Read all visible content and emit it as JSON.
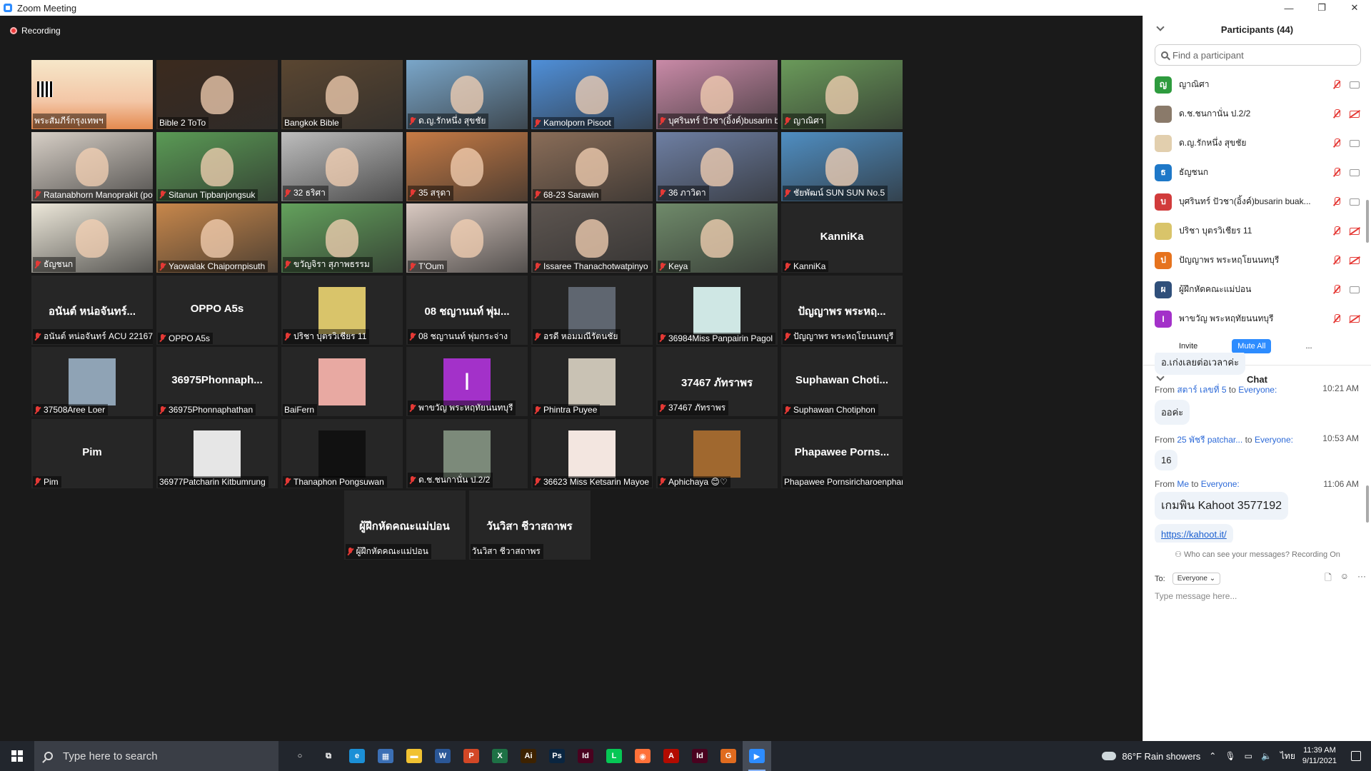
{
  "window": {
    "title": "Zoom Meeting",
    "minimize": "—",
    "restore": "❐",
    "close": "✕"
  },
  "recording": {
    "label": "Recording"
  },
  "tiles": [
    {
      "row": 0,
      "col": 0,
      "label": "พระสัมภีร์กรุงเทพฯ",
      "kind": "poster",
      "mic_off": false
    },
    {
      "row": 0,
      "col": 1,
      "label": "Bible 2 ToTo",
      "kind": "photo",
      "color": "#3b2a1e",
      "mic_off": false
    },
    {
      "row": 0,
      "col": 2,
      "label": "Bangkok Bible",
      "kind": "photo",
      "color": "#5a4631",
      "mic_off": false,
      "active": true
    },
    {
      "row": 0,
      "col": 3,
      "label": "ด.ญ.รักหนึ่ง สุขชัย",
      "kind": "photo",
      "color": "#7aa6c9",
      "mic_off": true
    },
    {
      "row": 0,
      "col": 4,
      "label": "Kamolporn Pisoot",
      "kind": "photo",
      "color": "#4f8fd8",
      "mic_off": true
    },
    {
      "row": 0,
      "col": 5,
      "label": "บุศรินทร์ ปัวชา(อิ้งค์)busarin bu...",
      "kind": "photo",
      "color": "#c98aa7",
      "mic_off": true
    },
    {
      "row": 0,
      "col": 6,
      "label": "ญาณิศา",
      "kind": "photo",
      "color": "#6a9a5a",
      "mic_off": true
    },
    {
      "row": 1,
      "col": 0,
      "label": "Ratanabhorn Manoprakit (pow)",
      "kind": "photo",
      "color": "#d7cfc6",
      "mic_off": true
    },
    {
      "row": 1,
      "col": 1,
      "label": "Sitanun Tipbanjongsuk",
      "kind": "photo",
      "color": "#5a9a55",
      "mic_off": true
    },
    {
      "row": 1,
      "col": 2,
      "label": "32 ธริศา",
      "kind": "photo",
      "color": "#bdbdbd",
      "mic_off": true
    },
    {
      "row": 1,
      "col": 3,
      "label": "35 สรุดา",
      "kind": "photo",
      "color": "#c77b45",
      "mic_off": true
    },
    {
      "row": 1,
      "col": 4,
      "label": "68-23 Sarawin",
      "kind": "photo",
      "color": "#8a6d58",
      "mic_off": true
    },
    {
      "row": 1,
      "col": 5,
      "label": "36 ภาวิดา",
      "kind": "photo",
      "color": "#6e7fa3",
      "mic_off": true
    },
    {
      "row": 1,
      "col": 6,
      "label": "ชัยพัฒน์ SUN SUN No.5",
      "kind": "photo",
      "color": "#4f8ec2",
      "mic_off": true
    },
    {
      "row": 2,
      "col": 0,
      "label": "ธัญชนก",
      "kind": "photo",
      "color": "#ece7d9",
      "mic_off": true
    },
    {
      "row": 2,
      "col": 1,
      "label": "Yaowalak Chaipornpisuth",
      "kind": "photo",
      "color": "#c7874b",
      "mic_off": true
    },
    {
      "row": 2,
      "col": 2,
      "label": "ขวัญจิรา สุภาพธรรม",
      "kind": "photo",
      "color": "#63a15c",
      "mic_off": true
    },
    {
      "row": 2,
      "col": 3,
      "label": "T'Oum",
      "kind": "photo",
      "color": "#d9c9c1",
      "mic_off": true
    },
    {
      "row": 2,
      "col": 4,
      "label": "Issaree Thanachotwatpinyo",
      "kind": "photo",
      "color": "#5d5550",
      "mic_off": true
    },
    {
      "row": 2,
      "col": 5,
      "label": "Keya",
      "kind": "photo",
      "color": "#6f8a6a",
      "mic_off": true
    },
    {
      "row": 2,
      "col": 6,
      "label": "KanniKa",
      "kind": "name",
      "center": "KanniKa",
      "mic_off": true
    },
    {
      "row": 3,
      "col": 0,
      "label": "อนันต์ หน่อจันทร์ ACU 22167",
      "kind": "name",
      "center": "อนันต์ หน่อจันทร์...",
      "mic_off": true
    },
    {
      "row": 3,
      "col": 1,
      "label": "OPPO A5s",
      "kind": "name",
      "center": "OPPO A5s",
      "mic_off": true
    },
    {
      "row": 3,
      "col": 2,
      "label": "ปริชา บุตรวิเชียร  11",
      "kind": "avatar",
      "color": "#d9c46a",
      "mic_off": true
    },
    {
      "row": 3,
      "col": 3,
      "label": "08 ชญานนท์ พุ่มกระจ่าง",
      "kind": "name",
      "center": "08 ชญานนท์ พุ่ม...",
      "mic_off": true
    },
    {
      "row": 3,
      "col": 4,
      "label": "อรดี หอมมณีรัตนชัย",
      "kind": "avatar",
      "color": "#5f6670",
      "mic_off": true
    },
    {
      "row": 3,
      "col": 5,
      "label": "36984Miss Panpairin Pagol",
      "kind": "avatar",
      "color": "#cfe7e4",
      "mic_off": true
    },
    {
      "row": 3,
      "col": 6,
      "label": "ปัญญาพร พระหฤโยนนทบุรี",
      "kind": "name",
      "center": "ปัญญาพร พระหฤ...",
      "mic_off": true
    },
    {
      "row": 4,
      "col": 0,
      "label": "37508Aree Loer",
      "kind": "avatar",
      "color": "#8fa3b5",
      "mic_off": true
    },
    {
      "row": 4,
      "col": 1,
      "label": "36975Phonnaphathan",
      "kind": "name",
      "center": "36975Phonnaph...",
      "mic_off": true
    },
    {
      "row": 4,
      "col": 2,
      "label": "BaiFern",
      "kind": "avatar",
      "color": "#e8a9a2",
      "mic_off": false
    },
    {
      "row": 4,
      "col": 3,
      "label": "พาขวัญ พระหฤทัยนนทบุรี",
      "kind": "letter",
      "letter": "I",
      "color": "#a331c9",
      "mic_off": true
    },
    {
      "row": 4,
      "col": 4,
      "label": "Phintra Puyee",
      "kind": "avatar",
      "color": "#c9c2b4",
      "mic_off": true
    },
    {
      "row": 4,
      "col": 5,
      "label": "37467 ภัทราพร",
      "kind": "name",
      "center": "37467 ภัทราพร",
      "mic_off": true
    },
    {
      "row": 4,
      "col": 6,
      "label": "Suphawan Chotiphon",
      "kind": "name",
      "center": "Suphawan  Choti...",
      "mic_off": true
    },
    {
      "row": 5,
      "col": 0,
      "label": "Pim",
      "kind": "name",
      "center": "Pim",
      "mic_off": true
    },
    {
      "row": 5,
      "col": 1,
      "label": "36977Patcharin Kitbumrung",
      "kind": "avatar",
      "color": "#e6e6e6",
      "mic_off": false
    },
    {
      "row": 5,
      "col": 2,
      "label": "Thanaphon Pongsuwan",
      "kind": "avatar",
      "color": "#111111",
      "mic_off": true
    },
    {
      "row": 5,
      "col": 3,
      "label": "ด.ช.ชนกานั่น ป.2/2",
      "kind": "avatar",
      "color": "#7c8a7a",
      "mic_off": true
    },
    {
      "row": 5,
      "col": 4,
      "label": "36623 Miss Ketsarin Mayoe",
      "kind": "avatar",
      "color": "#f3e6e0",
      "mic_off": true
    },
    {
      "row": 5,
      "col": 5,
      "label": "Aphichaya 😊♡",
      "kind": "avatar",
      "color": "#a0682f",
      "mic_off": true
    },
    {
      "row": 5,
      "col": 6,
      "label": "Phapawee Pornsiricharoenphan",
      "kind": "name",
      "center": "Phapawee  Porns...",
      "mic_off": false
    },
    {
      "row": 6,
      "col": 2.5,
      "label": "ผู้ฝึกหัดคณะแม่ปอน",
      "kind": "name",
      "center": "ผู้ฝึกหัดคณะแม่ปอน",
      "mic_off": true
    },
    {
      "row": 6,
      "col": 3.5,
      "label": "วันวิสา ชีวาสถาพร",
      "kind": "name",
      "center": "วันวิสา ชีวาสถาพร",
      "mic_off": false
    }
  ],
  "participants": {
    "title": "Participants (44)",
    "search_placeholder": "Find a participant",
    "list": [
      {
        "name": "ญาณิศา",
        "initial": "ญ",
        "color": "#2e9b3e",
        "cam_off": false
      },
      {
        "name": "ด.ช.ชนกานั่น ป.2/2",
        "initial": "",
        "color": "#8a7a6a",
        "cam_off": true
      },
      {
        "name": "ด.ญ.รักหนึ่ง สุขชัย",
        "initial": "",
        "color": "#e2cfae",
        "cam_off": false
      },
      {
        "name": "ธัญชนก",
        "initial": "ธ",
        "color": "#1e78c8",
        "cam_off": false
      },
      {
        "name": "บุศรินทร์ ปัวชา(อิ้งค์)busarin buak...",
        "initial": "บ",
        "color": "#d13b3b",
        "cam_off": false
      },
      {
        "name": "ปริชา บุตรวิเชียร  11",
        "initial": "",
        "color": "#d9c46a",
        "cam_off": true
      },
      {
        "name": "ปัญญาพร พระหฤโยนนทบุรี",
        "initial": "ป",
        "color": "#e6731e",
        "cam_off": true
      },
      {
        "name": "ผู้ฝึกหัดคณะแม่ปอน",
        "initial": "ผ",
        "color": "#2f4f7a",
        "cam_off": false
      },
      {
        "name": "พาขวัญ พระหฤทัยนนทบุรี",
        "initial": "I",
        "color": "#a331c9",
        "cam_off": true
      }
    ],
    "buttons": {
      "invite": "Invite",
      "mute_all": "Mute All",
      "more": "..."
    }
  },
  "chat": {
    "title": "Chat",
    "top_bubble": "อ.เก่งเลยต่อเวลาค่ะ",
    "messages": [
      {
        "from": "From",
        "sender": "สตาร์ เลขที่ 5",
        "to": "to",
        "target": "Everyone:",
        "time": "10:21 AM",
        "text": "ออค่ะ"
      },
      {
        "from": "From",
        "sender": "25 พัชรี patchar...",
        "to": "to",
        "target": "Everyone:",
        "time": "10:53 AM",
        "text": "16"
      },
      {
        "from": "From",
        "sender": "Me",
        "to": "to",
        "target": "Everyone:",
        "time": "11:06 AM",
        "text": "เกมพิน Kahoot 3577192",
        "link": "https://kahoot.it/"
      }
    ],
    "who_can_see": "Who can see your messages? Recording On",
    "to_label": "To:",
    "to_value": "Everyone",
    "input_placeholder": "Type message here..."
  },
  "taskbar": {
    "search_placeholder": "Type here to search",
    "weather": "86°F  Rain showers",
    "lang": "ไทย",
    "time": "11:39 AM",
    "date": "9/11/2021",
    "apps": [
      {
        "name": "cortana-icon",
        "color": "transparent",
        "text": "○"
      },
      {
        "name": "task-view-icon",
        "color": "transparent",
        "text": "⧉"
      },
      {
        "name": "edge-icon",
        "color": "#1b8fd6",
        "text": "e"
      },
      {
        "name": "calculator-icon",
        "color": "#3b6fb5",
        "text": "▦"
      },
      {
        "name": "file-explorer-icon",
        "color": "#f1c232",
        "text": "▬"
      },
      {
        "name": "word-icon",
        "color": "#2b5797",
        "text": "W"
      },
      {
        "name": "powerpoint-icon",
        "color": "#d24726",
        "text": "P"
      },
      {
        "name": "excel-icon",
        "color": "#1e7145",
        "text": "X"
      },
      {
        "name": "illustrator-icon",
        "color": "#3d2200",
        "text": "Ai"
      },
      {
        "name": "photoshop-icon",
        "color": "#0a2540",
        "text": "Ps"
      },
      {
        "name": "indesign-icon",
        "color": "#49021f",
        "text": "Id"
      },
      {
        "name": "line-icon",
        "color": "#06c755",
        "text": "L"
      },
      {
        "name": "firefox-icon",
        "color": "#ff7139",
        "text": "◉"
      },
      {
        "name": "acrobat-icon",
        "color": "#b30b00",
        "text": "A"
      },
      {
        "name": "indesign2-icon",
        "color": "#49021f",
        "text": "Id"
      },
      {
        "name": "grammarly-icon",
        "color": "#e06b1f",
        "text": "G"
      },
      {
        "name": "zoom-icon",
        "color": "#2d8cff",
        "text": "▶",
        "active": true
      }
    ]
  }
}
